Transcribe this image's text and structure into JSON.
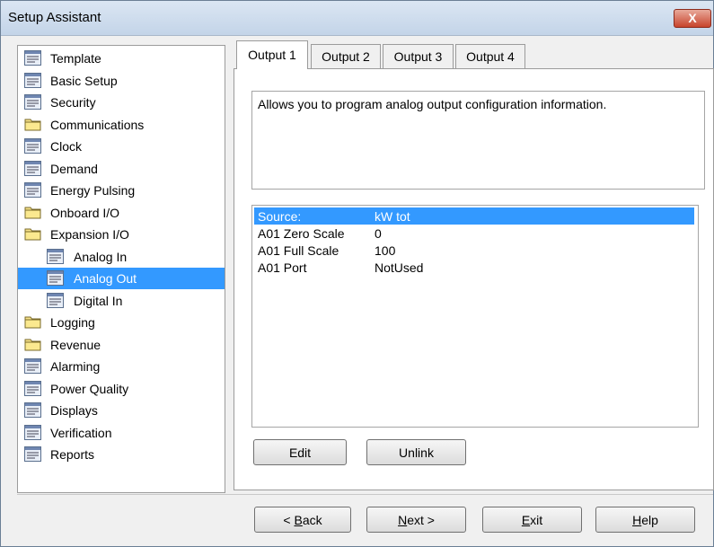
{
  "window": {
    "title": "Setup Assistant",
    "close_glyph": "X"
  },
  "tree": {
    "items": [
      {
        "label": "Template",
        "icon": "form-icon",
        "indent": 0,
        "selected": false
      },
      {
        "label": "Basic Setup",
        "icon": "form-icon",
        "indent": 0,
        "selected": false
      },
      {
        "label": "Security",
        "icon": "form-icon",
        "indent": 0,
        "selected": false
      },
      {
        "label": "Communications",
        "icon": "folder-icon",
        "indent": 0,
        "selected": false
      },
      {
        "label": "Clock",
        "icon": "form-icon",
        "indent": 0,
        "selected": false
      },
      {
        "label": "Demand",
        "icon": "form-icon",
        "indent": 0,
        "selected": false
      },
      {
        "label": "Energy Pulsing",
        "icon": "form-icon",
        "indent": 0,
        "selected": false
      },
      {
        "label": "Onboard I/O",
        "icon": "folder-icon",
        "indent": 0,
        "selected": false
      },
      {
        "label": "Expansion I/O",
        "icon": "folder-icon",
        "indent": 0,
        "selected": false
      },
      {
        "label": "Analog In",
        "icon": "form-icon",
        "indent": 1,
        "selected": false
      },
      {
        "label": "Analog Out",
        "icon": "form-icon",
        "indent": 1,
        "selected": true
      },
      {
        "label": "Digital In",
        "icon": "form-icon",
        "indent": 1,
        "selected": false
      },
      {
        "label": "Logging",
        "icon": "folder-icon",
        "indent": 0,
        "selected": false
      },
      {
        "label": "Revenue",
        "icon": "folder-icon",
        "indent": 0,
        "selected": false
      },
      {
        "label": "Alarming",
        "icon": "form-icon",
        "indent": 0,
        "selected": false
      },
      {
        "label": "Power Quality",
        "icon": "form-icon",
        "indent": 0,
        "selected": false
      },
      {
        "label": "Displays",
        "icon": "form-icon",
        "indent": 0,
        "selected": false
      },
      {
        "label": "Verification",
        "icon": "form-icon",
        "indent": 0,
        "selected": false
      },
      {
        "label": "Reports",
        "icon": "form-icon",
        "indent": 0,
        "selected": false
      }
    ]
  },
  "tabs": [
    {
      "label": "Output 1",
      "active": true
    },
    {
      "label": "Output 2",
      "active": false
    },
    {
      "label": "Output 3",
      "active": false
    },
    {
      "label": "Output 4",
      "active": false
    }
  ],
  "description": "Allows you to program analog output configuration information.",
  "properties": [
    {
      "name": "Source:",
      "value": "kW tot",
      "selected": true
    },
    {
      "name": "A01 Zero Scale",
      "value": "0",
      "selected": false
    },
    {
      "name": "A01 Full Scale",
      "value": "100",
      "selected": false
    },
    {
      "name": "A01 Port",
      "value": "NotUsed",
      "selected": false
    }
  ],
  "panel_buttons": {
    "edit": "Edit",
    "unlink": "Unlink"
  },
  "nav_buttons": {
    "back": {
      "prefix": "< ",
      "accel": "B",
      "rest": "ack"
    },
    "next": {
      "accel": "N",
      "rest": "ext >"
    },
    "exit": {
      "accel": "E",
      "rest": "xit"
    },
    "help": {
      "accel": "H",
      "rest": "elp"
    }
  },
  "colors": {
    "selection": "#3399ff",
    "title_gradient_top": "#dbe6f3",
    "close_red": "#c7442c"
  }
}
